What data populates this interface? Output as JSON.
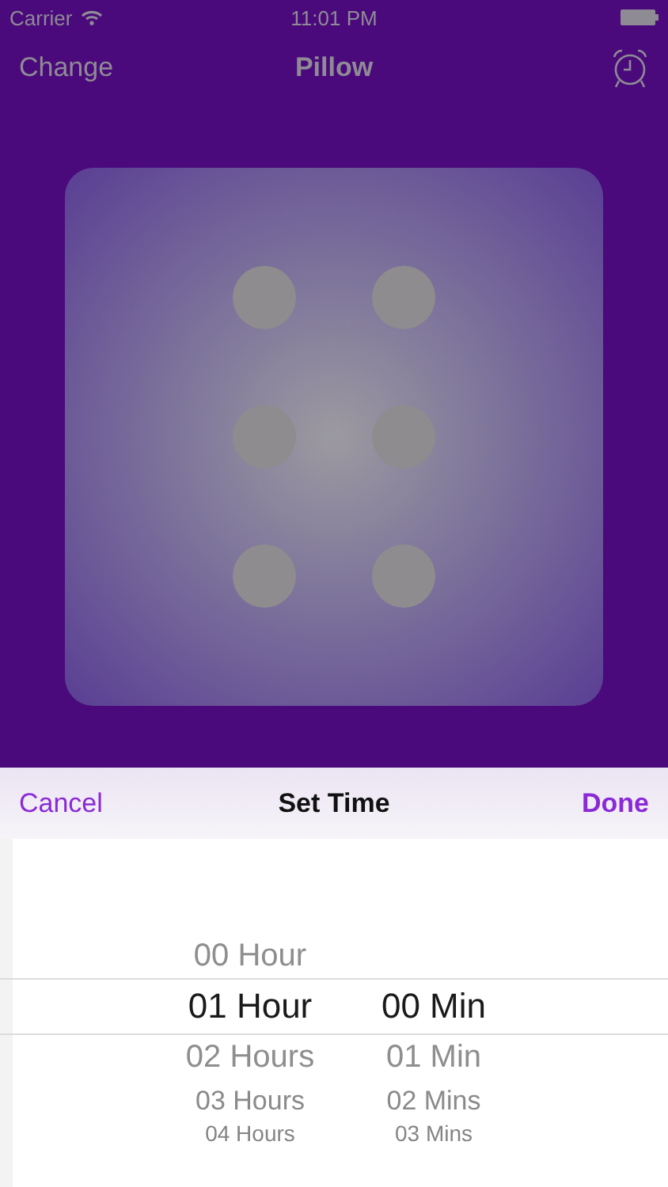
{
  "status_bar": {
    "carrier": "Carrier",
    "time": "11:01 PM"
  },
  "nav_bar": {
    "left": "Change",
    "title": "Pillow"
  },
  "sheet": {
    "cancel": "Cancel",
    "title": "Set Time",
    "done": "Done"
  },
  "picker": {
    "columns": [
      {
        "items": [
          {
            "label": "00 Hour",
            "selected": false
          },
          {
            "label": "01 Hour",
            "selected": true
          },
          {
            "label": "02 Hours",
            "selected": false
          },
          {
            "label": "03 Hours",
            "selected": false
          },
          {
            "label": "04 Hours",
            "selected": false
          }
        ]
      },
      {
        "items": [
          {
            "label": "00 Min",
            "selected": true
          },
          {
            "label": "01 Min",
            "selected": false
          },
          {
            "label": "02 Mins",
            "selected": false
          },
          {
            "label": "03 Mins",
            "selected": false
          }
        ]
      }
    ]
  }
}
